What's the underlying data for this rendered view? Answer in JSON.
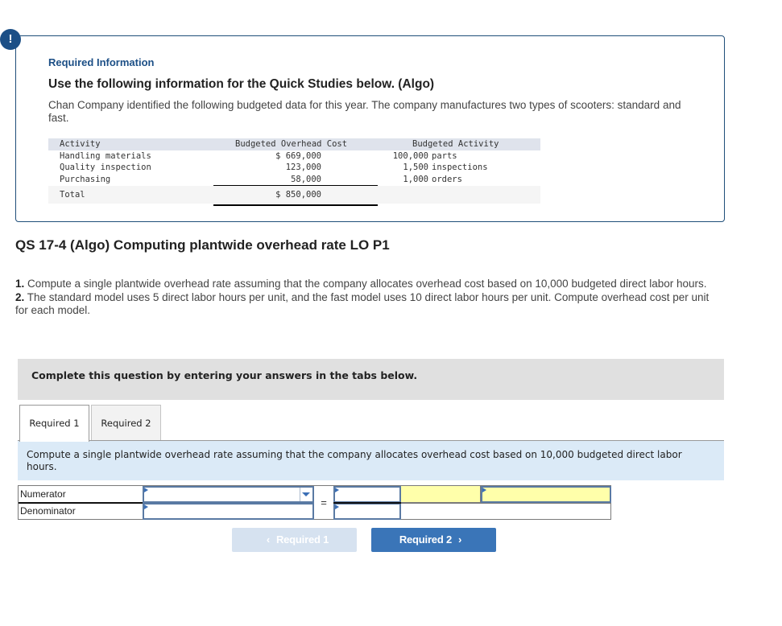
{
  "info_card": {
    "badge": "!",
    "label": "Required Information",
    "heading": "Use the following information for the Quick Studies below. (Algo)",
    "text": "Chan Company identified the following budgeted data for this year. The company manufactures two types of scooters: standard and fast."
  },
  "data_table": {
    "headers": [
      "Activity",
      "Budgeted Overhead Cost",
      "Budgeted Activity"
    ],
    "rows": [
      {
        "activity": "Handling materials",
        "cost": "$ 669,000",
        "qty": "100,000",
        "unit": "parts"
      },
      {
        "activity": "Quality inspection",
        "cost": "123,000",
        "qty": "1,500",
        "unit": "inspections"
      },
      {
        "activity": "Purchasing",
        "cost": "58,000",
        "qty": "1,000",
        "unit": "orders"
      }
    ],
    "total": {
      "label": "Total",
      "cost": "$ 850,000"
    }
  },
  "question": {
    "title": "QS 17-4 (Algo) Computing plantwide overhead rate LO P1",
    "items": [
      {
        "num": "1.",
        "text": " Compute a single plantwide overhead rate assuming that the company allocates overhead cost based on 10,000 budgeted direct labor hours."
      },
      {
        "num": "2.",
        "text": " The standard model uses 5 direct labor hours per unit, and the fast model uses 10 direct labor hours per unit. Compute overhead cost per unit for each model."
      }
    ]
  },
  "complete_box": {
    "text": "Complete this question by entering your answers in the tabs below."
  },
  "tabs": [
    {
      "label": "Required 1",
      "active": true
    },
    {
      "label": "Required 2",
      "active": false
    }
  ],
  "prompt": "Compute a single plantwide overhead rate assuming that the company allocates overhead cost based on 10,000 budgeted direct labor hours.",
  "answer_grid": {
    "numerator_label": "Numerator",
    "denominator_label": "Denominator",
    "equals": "=",
    "numerator_select": "",
    "denominator_input": "",
    "numerator_value": "",
    "denominator_value": "",
    "result_label": "",
    "result_value": ""
  },
  "nav": {
    "prev_label": "Required 1",
    "next_label": "Required 2",
    "prev_icon": "‹",
    "next_icon": "›"
  }
}
